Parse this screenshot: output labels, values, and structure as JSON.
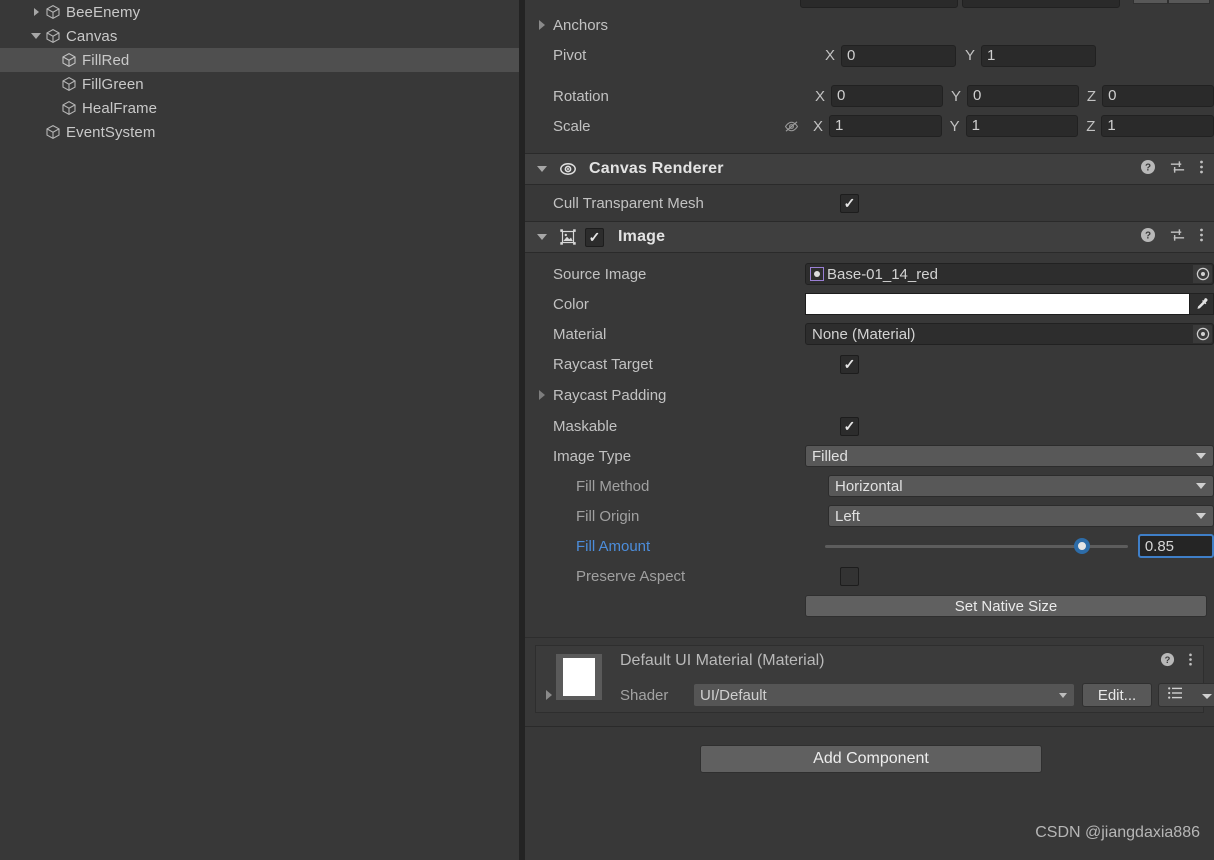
{
  "hierarchy": {
    "items": [
      {
        "label": "BeeEnemy",
        "indent": 1,
        "foldout": "closed",
        "selected": false,
        "icon": "cube-icon"
      },
      {
        "label": "Canvas",
        "indent": 1,
        "foldout": "open",
        "selected": false,
        "icon": "cube-icon"
      },
      {
        "label": "FillRed",
        "indent": 2,
        "foldout": "none",
        "selected": true,
        "icon": "cube-icon"
      },
      {
        "label": "FillGreen",
        "indent": 2,
        "foldout": "none",
        "selected": false,
        "icon": "cube-icon"
      },
      {
        "label": "HealFrame",
        "indent": 2,
        "foldout": "none",
        "selected": false,
        "icon": "cube-icon"
      },
      {
        "label": "EventSystem",
        "indent": 1,
        "foldout": "none",
        "selected": false,
        "icon": "cube-icon"
      }
    ]
  },
  "inspector": {
    "rect_transform": {
      "anchors_label": "Anchors",
      "pivot": {
        "label": "Pivot",
        "x_label": "X",
        "x": "0",
        "y_label": "Y",
        "y": "1"
      },
      "rotation": {
        "label": "Rotation",
        "x_label": "X",
        "x": "0",
        "y_label": "Y",
        "y": "0",
        "z_label": "Z",
        "z": "0"
      },
      "scale": {
        "label": "Scale",
        "constrain_icon": "eye-off-icon",
        "x_label": "X",
        "x": "1",
        "y_label": "Y",
        "y": "1",
        "z_label": "Z",
        "z": "1"
      }
    },
    "canvas_renderer": {
      "title": "Canvas Renderer",
      "icon": "eye-icon",
      "help_icon": "help-icon",
      "preset_icon": "preset-sliders-icon",
      "menu_icon": "kebab-menu-icon",
      "cull_transparent_mesh": {
        "label": "Cull Transparent Mesh",
        "checked": true
      }
    },
    "image": {
      "title": "Image",
      "icon": "image-component-icon",
      "enabled": true,
      "help_icon": "help-icon",
      "preset_icon": "preset-sliders-icon",
      "menu_icon": "kebab-menu-icon",
      "source_image": {
        "label": "Source Image",
        "value": "Base-01_14_red",
        "icon": "sprite-icon",
        "picker_icon": "object-picker-icon"
      },
      "color": {
        "label": "Color",
        "value_hex": "#ffffff",
        "eyedropper_icon": "eyedropper-icon"
      },
      "material": {
        "label": "Material",
        "value": "None (Material)",
        "picker_icon": "object-picker-icon"
      },
      "raycast_target": {
        "label": "Raycast Target",
        "checked": true
      },
      "raycast_padding": {
        "label": "Raycast Padding",
        "expanded": false
      },
      "maskable": {
        "label": "Maskable",
        "checked": true
      },
      "image_type": {
        "label": "Image Type",
        "value": "Filled"
      },
      "fill_method": {
        "label": "Fill Method",
        "value": "Horizontal"
      },
      "fill_origin": {
        "label": "Fill Origin",
        "value": "Left"
      },
      "fill_amount": {
        "label": "Fill Amount",
        "value": "0.85",
        "percent": 85,
        "accent_hex": "#4c8ddb"
      },
      "preserve_aspect": {
        "label": "Preserve Aspect",
        "checked": false
      },
      "set_native_size": {
        "label": "Set Native Size"
      }
    },
    "material_preview": {
      "title": "Default UI Material (Material)",
      "swatch_hex": "#ffffff",
      "shader_label": "Shader",
      "shader_value": "UI/Default",
      "edit_label": "Edit...",
      "help_icon": "help-icon",
      "menu_icon": "kebab-menu-icon",
      "preset_icon": "preset-list-icon"
    },
    "add_component": {
      "label": "Add Component"
    },
    "watermark": "CSDN @jiangdaxia886"
  }
}
